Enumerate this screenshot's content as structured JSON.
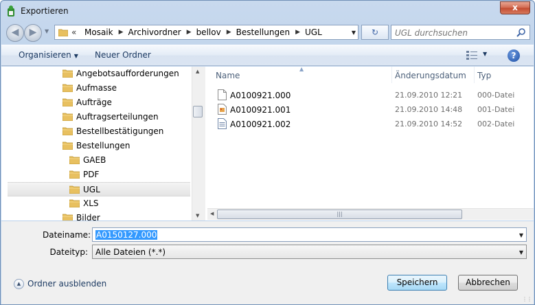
{
  "window": {
    "title": "Exportieren",
    "close_label": "x"
  },
  "address": {
    "overflow": "«",
    "breadcrumbs": [
      "Mosaik",
      "Archivordner",
      "bellov",
      "Bestellungen",
      "UGL"
    ]
  },
  "search": {
    "placeholder": "UGL durchsuchen"
  },
  "toolbar": {
    "organise_label": "Organisieren",
    "new_folder_label": "Neuer Ordner",
    "help_label": "?"
  },
  "tree": {
    "items": [
      {
        "label": "Angebotsaufforderungen",
        "level": 0
      },
      {
        "label": "Aufmasse",
        "level": 0
      },
      {
        "label": "Aufträge",
        "level": 0
      },
      {
        "label": "Auftragserteilungen",
        "level": 0
      },
      {
        "label": "Bestellbestätigungen",
        "level": 0
      },
      {
        "label": "Bestellungen",
        "level": 0
      },
      {
        "label": "GAEB",
        "level": 1
      },
      {
        "label": "PDF",
        "level": 1
      },
      {
        "label": "UGL",
        "level": 1,
        "selected": true
      },
      {
        "label": "XLS",
        "level": 1
      },
      {
        "label": "Bilder",
        "level": 0
      }
    ]
  },
  "files": {
    "columns": {
      "name": "Name",
      "date": "Änderungsdatum",
      "type": "Typ"
    },
    "rows": [
      {
        "name": "A0100921.000",
        "date": "21.09.2010 12:21",
        "type": "000-Datei",
        "icon": "blank-file-icon"
      },
      {
        "name": "A0100921.001",
        "date": "21.09.2010 14:48",
        "type": "001-Datei",
        "icon": "image-file-icon"
      },
      {
        "name": "A0100921.002",
        "date": "21.09.2010 14:52",
        "type": "002-Datei",
        "icon": "text-file-icon"
      }
    ]
  },
  "form": {
    "filename_label": "Dateiname:",
    "filename_value": "A0150127.000",
    "filetype_label": "Dateityp:",
    "filetype_value": "Alle Dateien (*.*)"
  },
  "footer": {
    "hide_folders_label": "Ordner ausblenden",
    "save_label": "Speichern",
    "cancel_label": "Abbrechen"
  },
  "colors": {
    "folder": "#e8c060",
    "selection_highlight": "#3399ff",
    "accent": "#1c3a62"
  }
}
